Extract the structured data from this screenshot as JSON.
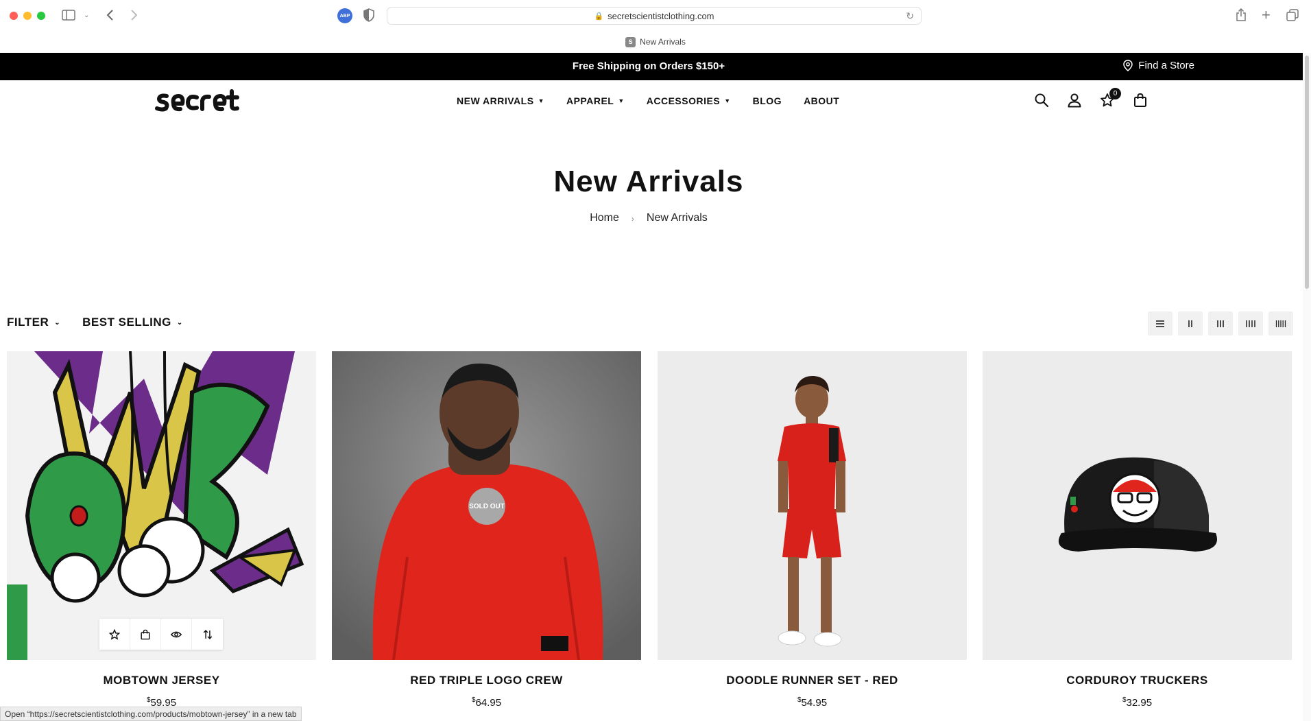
{
  "browser": {
    "url": "secretscientistclothing.com",
    "tab_title": "New Arrivals",
    "tab_favicon_letter": "S",
    "status_text": "Open “https://secretscientistclothing.com/products/mobtown-jersey” in a new tab"
  },
  "announcement": {
    "text": "Free Shipping on Orders $150+",
    "find_store": "Find a Store"
  },
  "header": {
    "nav": [
      {
        "label": "NEW ARRIVALS",
        "has_dropdown": true
      },
      {
        "label": "APPAREL",
        "has_dropdown": true
      },
      {
        "label": "ACCESSORIES",
        "has_dropdown": true
      },
      {
        "label": "BLOG",
        "has_dropdown": false
      },
      {
        "label": "ABOUT",
        "has_dropdown": false
      }
    ],
    "wishlist_count": "0"
  },
  "page": {
    "title": "New Arrivals",
    "breadcrumb": [
      "Home",
      "New Arrivals"
    ]
  },
  "toolbar": {
    "filter_label": "FILTER",
    "sort_label": "BEST SELLING"
  },
  "products": [
    {
      "name": "MOBTOWN JERSEY",
      "price": "59.95",
      "currency": "$",
      "sold_out": false
    },
    {
      "name": "RED TRIPLE LOGO CREW",
      "price": "64.95",
      "currency": "$",
      "sold_out": true,
      "badge": "SOLD OUT"
    },
    {
      "name": "DOODLE RUNNER SET - RED",
      "price": "54.95",
      "currency": "$",
      "sold_out": false
    },
    {
      "name": "CORDUROY TRUCKERS",
      "price": "32.95",
      "currency": "$",
      "sold_out": false
    }
  ],
  "colors": {
    "announcement_bg": "#000000",
    "text": "#111111",
    "sold_out_badge": "#a8a8a8",
    "crew_red": "#e0251c"
  }
}
